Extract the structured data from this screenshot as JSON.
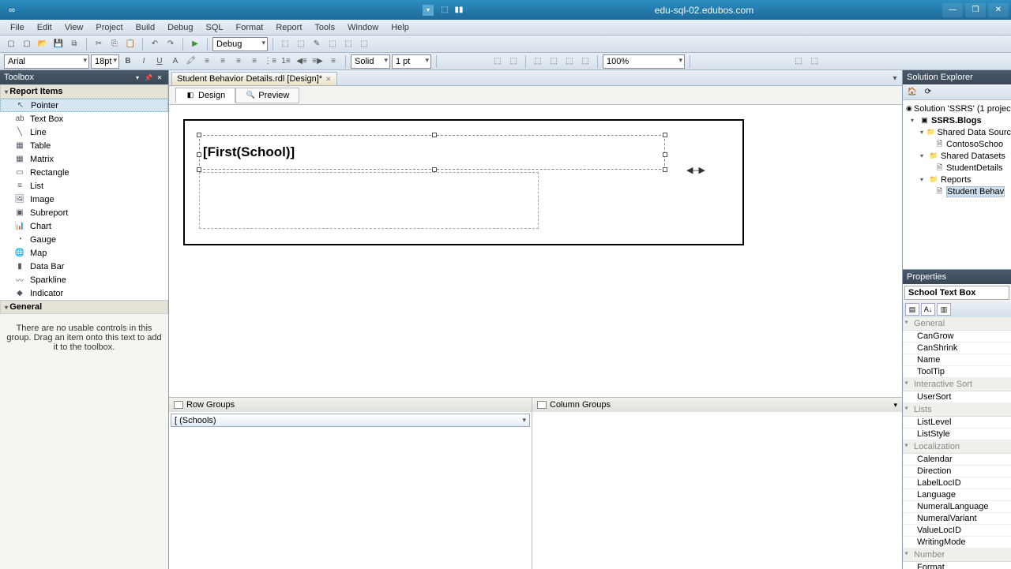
{
  "titlebar": {
    "title": "edu-sql-02.edubos.com"
  },
  "menu": [
    "File",
    "Edit",
    "View",
    "Project",
    "Build",
    "Debug",
    "SQL",
    "Format",
    "Report",
    "Tools",
    "Window",
    "Help"
  ],
  "toolbar1": {
    "config": "Debug"
  },
  "toolbar2": {
    "font": "Arial",
    "size": "18pt",
    "border_style": "Solid",
    "border_width": "1 pt",
    "zoom": "100%"
  },
  "toolbox": {
    "title": "Toolbox",
    "section": "Report Items",
    "items": [
      "Pointer",
      "Text Box",
      "Line",
      "Table",
      "Matrix",
      "Rectangle",
      "List",
      "Image",
      "Subreport",
      "Chart",
      "Gauge",
      "Map",
      "Data Bar",
      "Sparkline",
      "Indicator"
    ],
    "general": "General",
    "empty_text": "There are no usable controls in this group. Drag an item onto this text to add it to the toolbox."
  },
  "doc": {
    "tab": "Student Behavior Details.rdl [Design]*",
    "subtabs": [
      "Design",
      "Preview"
    ]
  },
  "designer": {
    "textbox_expr": "[First(School)]"
  },
  "groups": {
    "row_label": "Row Groups",
    "col_label": "Column Groups",
    "row_groups": [
      "[ (Schools)"
    ]
  },
  "solution": {
    "title": "Solution Explorer",
    "root": "Solution 'SSRS' (1 project",
    "project": "SSRS.Blogs",
    "folders": {
      "shared_ds": "Shared Data Sourc",
      "shared_ds_items": [
        "ContosoSchoo"
      ],
      "datasets": "Shared Datasets",
      "datasets_items": [
        "StudentDetails"
      ],
      "reports": "Reports",
      "reports_items": [
        "Student Behav"
      ]
    }
  },
  "properties": {
    "title": "Properties",
    "selected": "School Text Box",
    "categories": [
      {
        "name": "General",
        "props": [
          "CanGrow",
          "CanShrink",
          "Name",
          "ToolTip"
        ]
      },
      {
        "name": "Interactive Sort",
        "props": [
          "UserSort"
        ]
      },
      {
        "name": "Lists",
        "props": [
          "ListLevel",
          "ListStyle"
        ]
      },
      {
        "name": "Localization",
        "props": [
          "Calendar",
          "Direction",
          "LabelLocID",
          "Language",
          "NumeralLanguage",
          "NumeralVariant",
          "ValueLocID",
          "WritingMode"
        ]
      },
      {
        "name": "Number",
        "props": [
          "Format"
        ]
      }
    ]
  }
}
